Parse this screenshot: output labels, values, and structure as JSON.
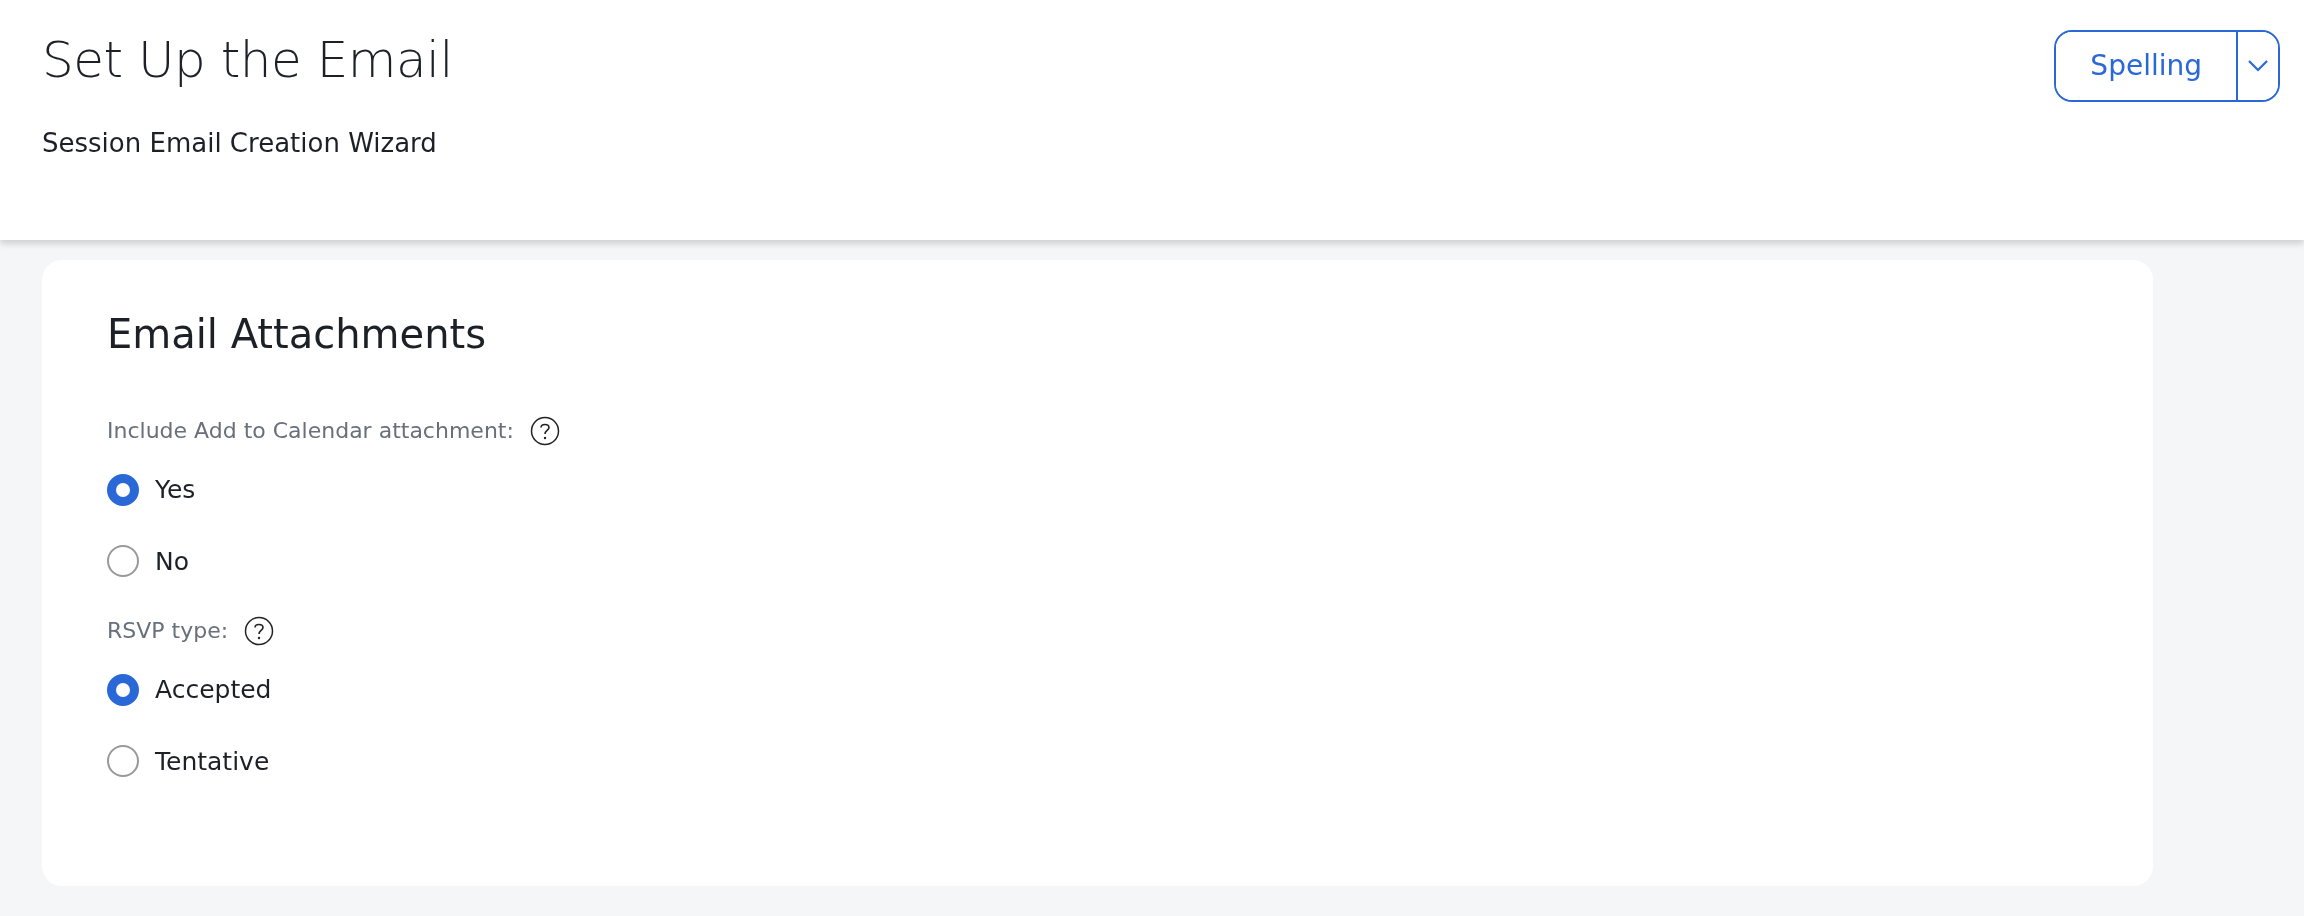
{
  "header": {
    "title": "Set Up the Email",
    "subtitle": "Session Email Creation Wizard",
    "spelling_button": {
      "label": "Spelling"
    }
  },
  "card": {
    "title": "Email Attachments",
    "groups": [
      {
        "label": "Include Add to Calendar attachment:",
        "options": [
          {
            "label": "Yes",
            "selected": true
          },
          {
            "label": "No",
            "selected": false
          }
        ]
      },
      {
        "label": "RSVP type:",
        "options": [
          {
            "label": "Accepted",
            "selected": true
          },
          {
            "label": "Tentative",
            "selected": false
          }
        ]
      }
    ]
  }
}
